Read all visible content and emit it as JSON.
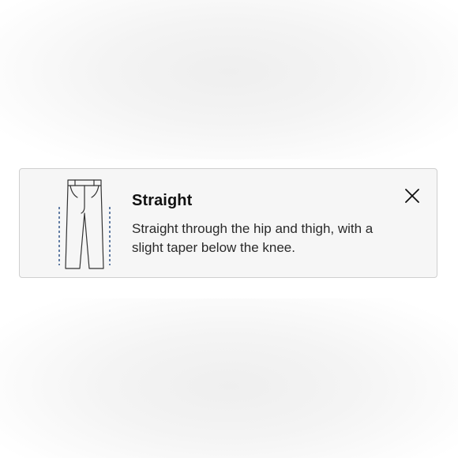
{
  "fit_card": {
    "title": "Straight",
    "description": "Straight through the hip and thigh, with a slight taper below the knee.",
    "illustration_icon": "pants-straight-fit-icon",
    "close_icon": "close-icon",
    "guide_line_color": "#3d5f8f"
  }
}
